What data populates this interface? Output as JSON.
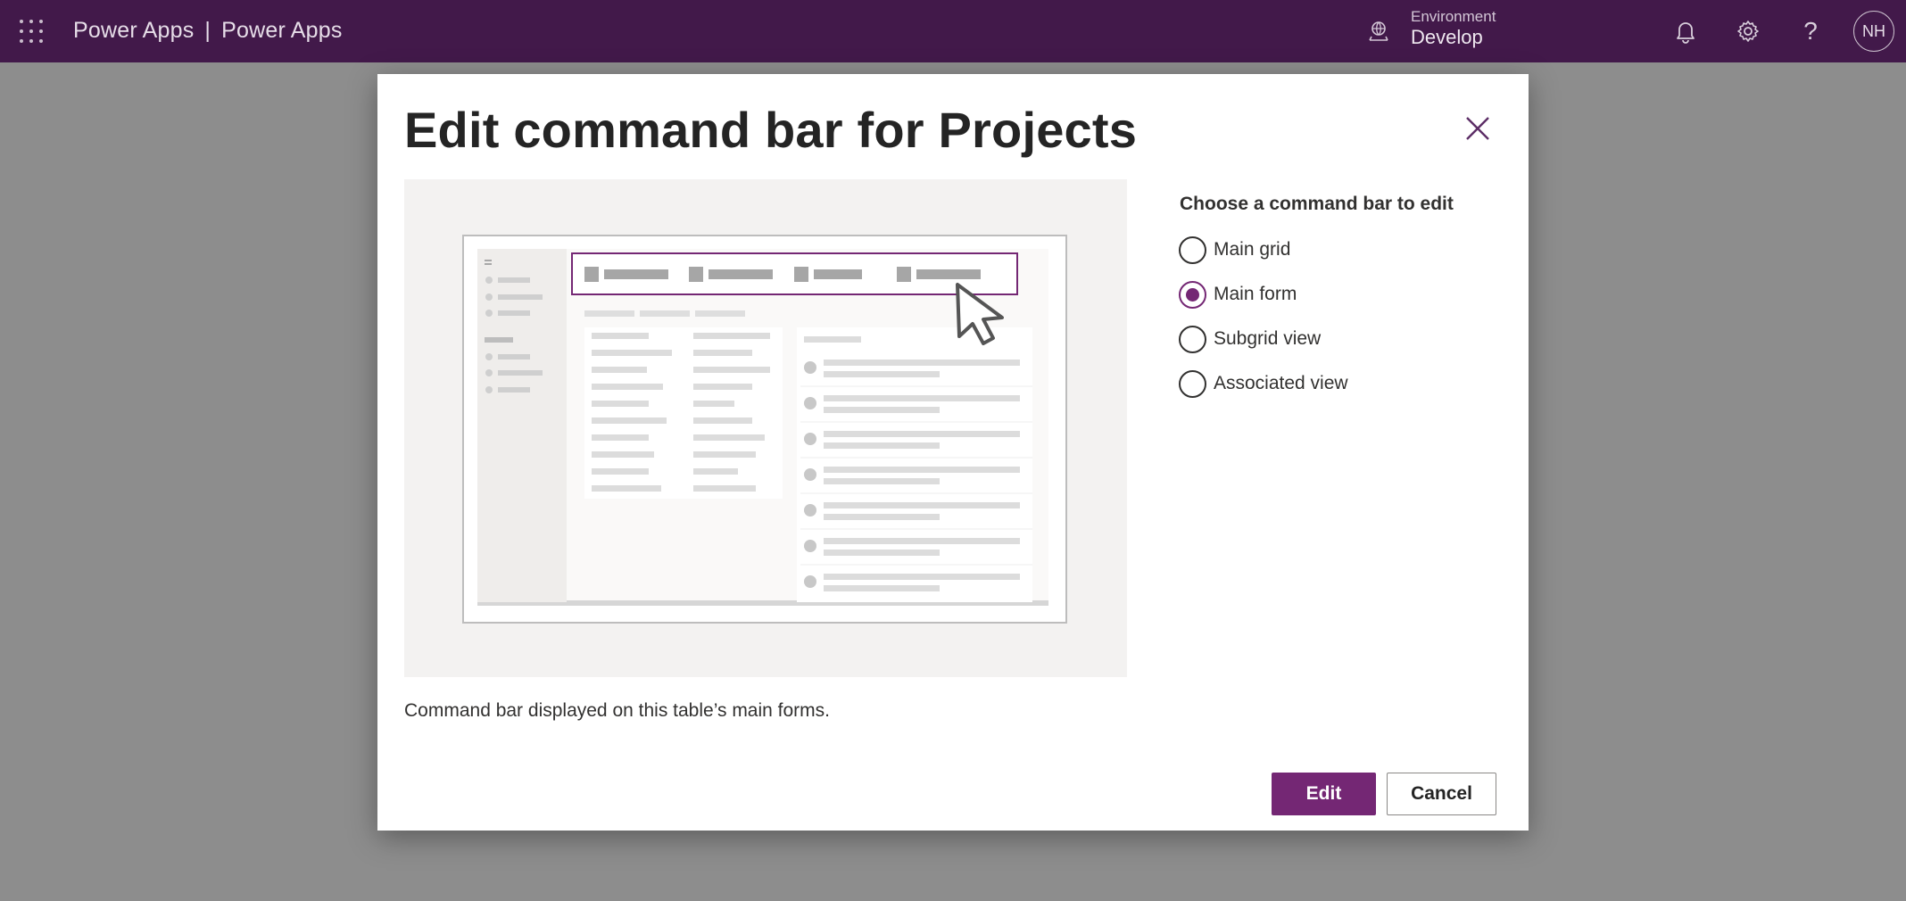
{
  "topbar": {
    "app_name": "Power Apps",
    "separator": "|",
    "env_name": "Power Apps",
    "environment_label": "Environment",
    "environment_value": "Develop",
    "help_glyph": "?",
    "avatar_initials": "NH",
    "icons": [
      "waffle-icon",
      "environment-icon",
      "bell-icon",
      "gear-icon",
      "help-icon"
    ]
  },
  "dialog": {
    "title": "Edit command bar for Projects",
    "caption": "Command bar displayed on this table’s main forms.",
    "choose_label": "Choose a command bar to edit",
    "options": [
      {
        "label": "Main grid",
        "checked": false
      },
      {
        "label": "Main form",
        "checked": true
      },
      {
        "label": "Subgrid view",
        "checked": false
      },
      {
        "label": "Associated view",
        "checked": false
      }
    ],
    "edit_label": "Edit",
    "cancel_label": "Cancel"
  },
  "colors": {
    "topbar": "#42194a",
    "accent": "#742774",
    "backdrop": "#8d8d8d"
  }
}
